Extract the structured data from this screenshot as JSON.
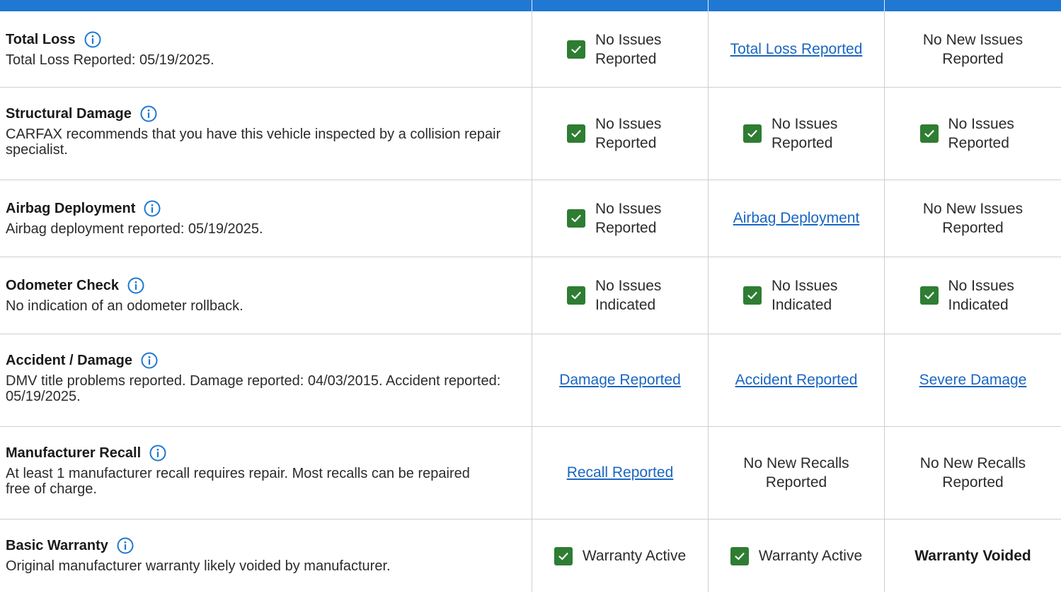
{
  "colors": {
    "header_blue": "#1f78d1",
    "check_green": "#2e7d32",
    "link_blue": "#1a66c2",
    "border": "#cfcfcf"
  },
  "rows": [
    {
      "title": "Total Loss",
      "icon": "info-icon",
      "description": "Total Loss Reported: 05/19/2025.",
      "cells": [
        {
          "type": "check",
          "text": "No Issues Reported"
        },
        {
          "type": "link",
          "text": "Total Loss Reported"
        },
        {
          "type": "plain",
          "text": "No New Issues Reported"
        }
      ]
    },
    {
      "title": "Structural Damage",
      "icon": "info-icon",
      "description": "CARFAX recommends that you have this vehicle inspected by a collision repair specialist.",
      "cells": [
        {
          "type": "check",
          "text": "No Issues Reported"
        },
        {
          "type": "check",
          "text": "No Issues Reported"
        },
        {
          "type": "check",
          "text": "No Issues Reported"
        }
      ]
    },
    {
      "title": "Airbag Deployment",
      "icon": "info-icon",
      "description": "Airbag deployment reported: 05/19/2025.",
      "cells": [
        {
          "type": "check",
          "text": "No Issues Reported"
        },
        {
          "type": "link",
          "text": "Airbag Deployment"
        },
        {
          "type": "plain",
          "text": "No New Issues Reported"
        }
      ]
    },
    {
      "title": "Odometer Check",
      "icon": "info-icon",
      "description": "No indication of an odometer rollback.",
      "cells": [
        {
          "type": "check",
          "text": "No Issues Indicated"
        },
        {
          "type": "check",
          "text": "No Issues Indicated"
        },
        {
          "type": "check",
          "text": "No Issues Indicated"
        }
      ]
    },
    {
      "title": "Accident / Damage",
      "icon": "info-icon",
      "description": "DMV title problems reported. Damage reported: 04/03/2015. Accident reported: 05/19/2025.",
      "cells": [
        {
          "type": "link",
          "text": "Damage Reported"
        },
        {
          "type": "link",
          "text": "Accident Reported"
        },
        {
          "type": "link",
          "text": "Severe Damage"
        }
      ]
    },
    {
      "title": "Manufacturer Recall",
      "icon": "info-icon",
      "description": "At least 1 manufacturer recall requires repair. Most recalls can be repaired free of charge.",
      "cells": [
        {
          "type": "link",
          "text": "Recall Reported"
        },
        {
          "type": "plain",
          "text": "No New Recalls Reported"
        },
        {
          "type": "plain",
          "text": "No New Recalls Reported"
        }
      ]
    },
    {
      "title": "Basic Warranty",
      "icon": "info-icon",
      "description": "Original manufacturer warranty likely voided by manufacturer.",
      "cells": [
        {
          "type": "check",
          "text": "Warranty Active"
        },
        {
          "type": "check",
          "text": "Warranty Active"
        },
        {
          "type": "bold",
          "text": "Warranty Voided"
        }
      ]
    }
  ]
}
